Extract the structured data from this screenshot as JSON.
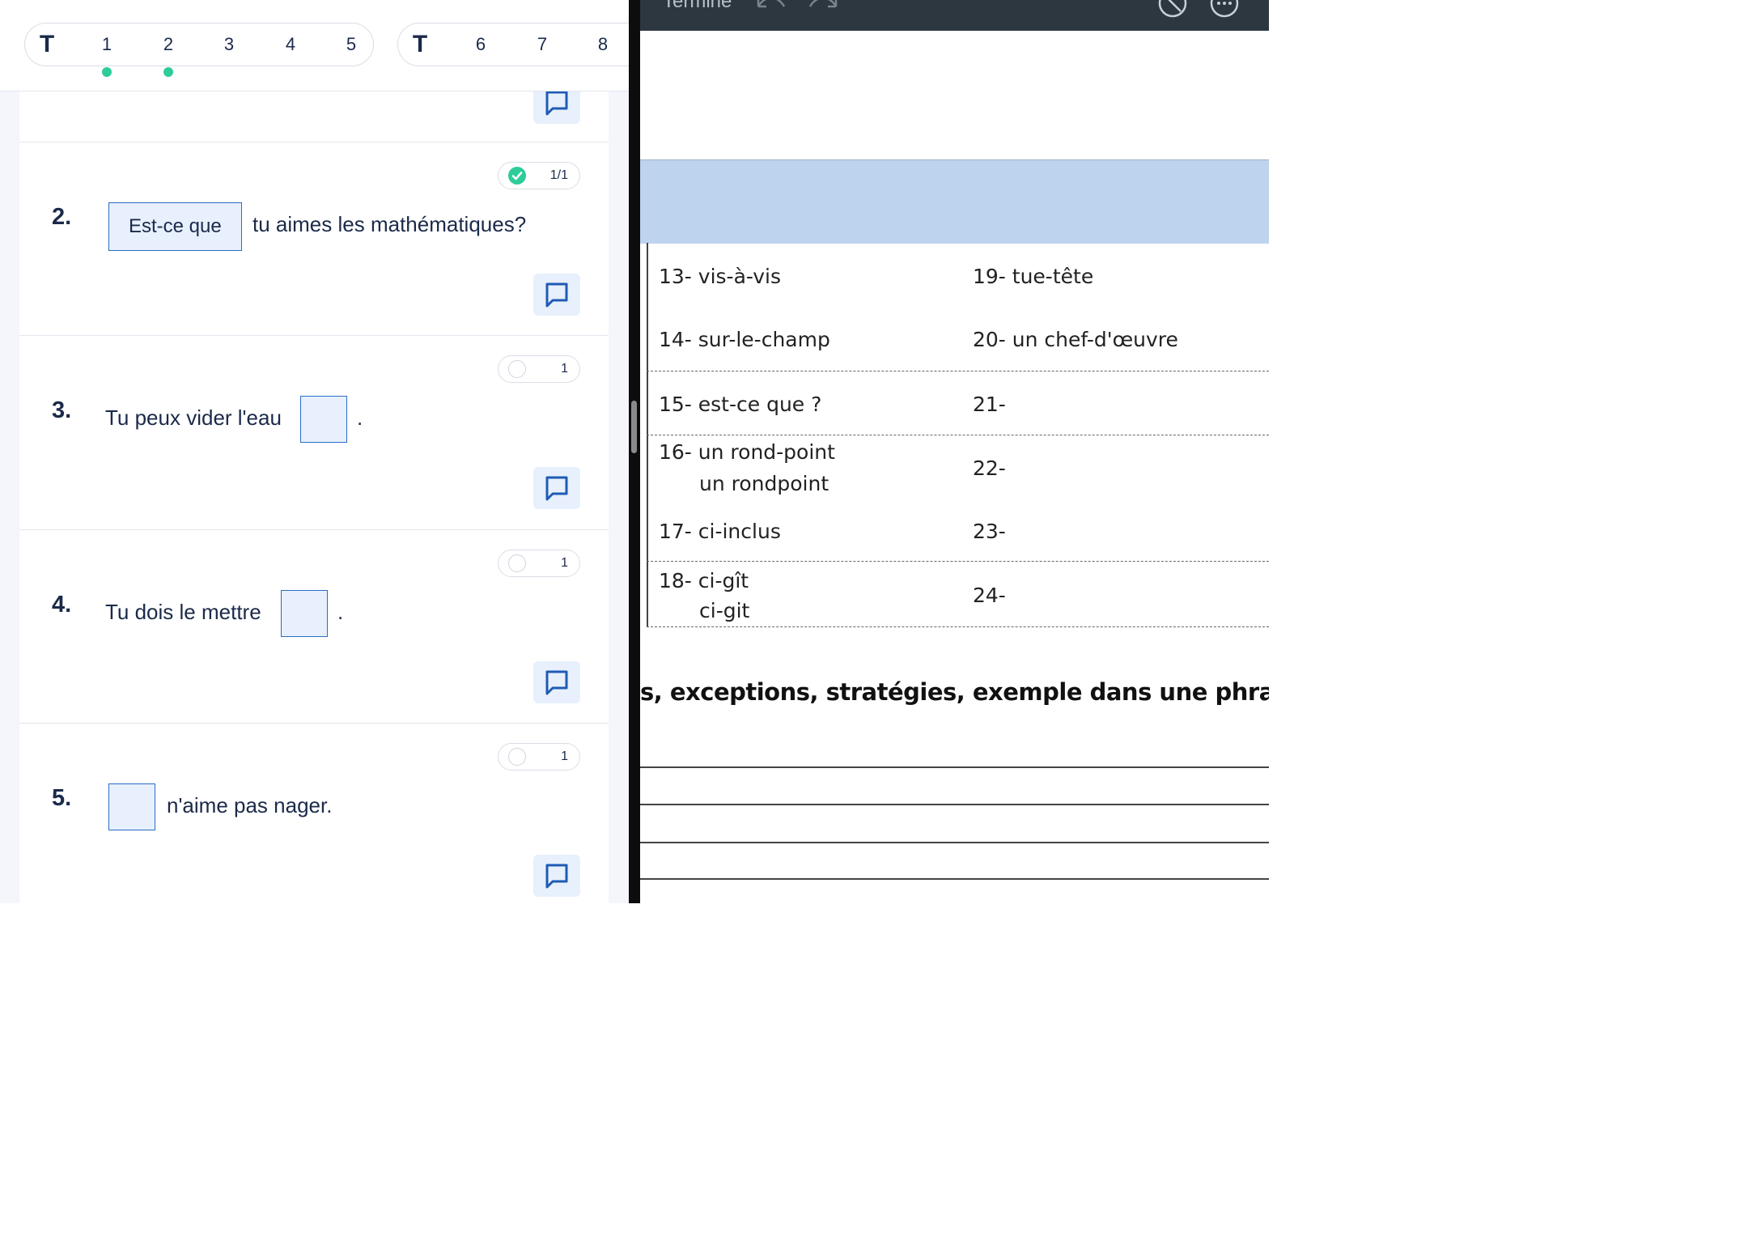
{
  "nav": {
    "group1": [
      "T",
      "1",
      "2",
      "3",
      "4",
      "5"
    ],
    "group2": [
      "T",
      "6",
      "7",
      "8"
    ]
  },
  "questions": [
    {
      "num": "2.",
      "score": "1/1",
      "answer": "Est-ce que",
      "text_after": "tu aimes les mathématiques?"
    },
    {
      "num": "3.",
      "score": "1",
      "text_before": "Tu peux vider l'eau",
      "text_after": "."
    },
    {
      "num": "4.",
      "score": "1",
      "text_before": "Tu dois le mettre",
      "text_after": "."
    },
    {
      "num": "5.",
      "score": "1",
      "text_after": "n'aime pas nager."
    }
  ],
  "doc": {
    "topbar_title": "Terminé",
    "rows": [
      {
        "left": "13- vis-à-vis",
        "right": "19- tue-tête"
      },
      {
        "left": "14- sur-le-champ",
        "right": "20- un chef-d'œuvre"
      },
      {
        "left": "15- est-ce que ?",
        "right": "21-"
      },
      {
        "left": "16- un rond-point",
        "left2": "un rondpoint",
        "right": "22-"
      },
      {
        "left": "17- ci-inclus",
        "right": "23-"
      },
      {
        "left": "18- ci-gît",
        "left2": "ci-git",
        "right": "24-"
      }
    ],
    "instruction": "s, exceptions, stratégies, exemple dans une phrase,"
  },
  "colors": {
    "accent": "#2b6cc4",
    "correct": "#2ecc9a",
    "band": "#bed3ed"
  }
}
